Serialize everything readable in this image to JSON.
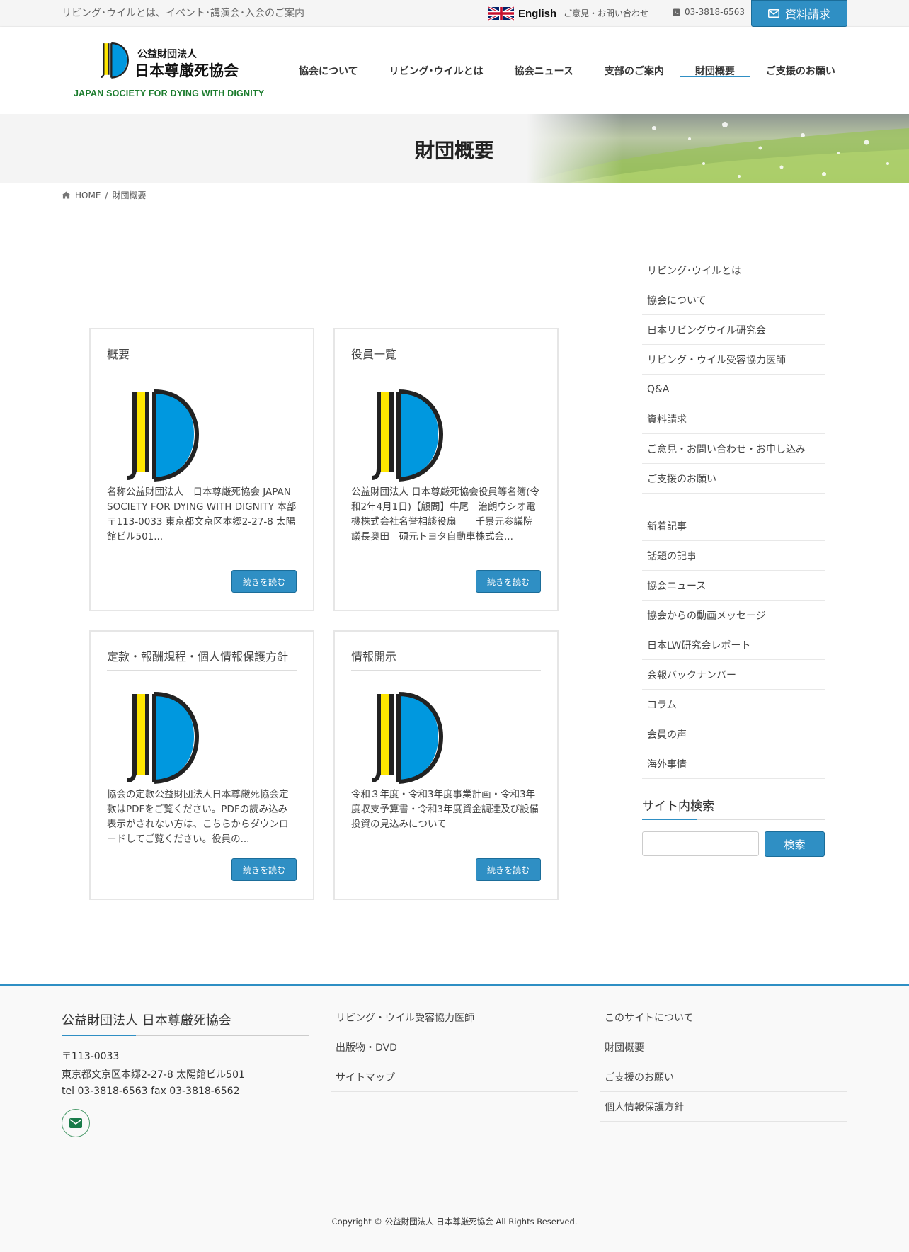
{
  "topbar": {
    "tagline": "リビング･ウイルとは、イベント･講演会･入会のご案内",
    "english_label": "English",
    "contact_label": "ご意見・お問い合わせ",
    "phone": "03-3818-6563",
    "request_button": "資料請求"
  },
  "header": {
    "logo_small": "公益財団法人",
    "logo_large": "日本尊厳死協会",
    "logo_en": "JAPAN SOCIETY FOR DYING WITH DIGNITY",
    "nav": [
      {
        "label": "協会について"
      },
      {
        "label": "リビング･ウイルとは"
      },
      {
        "label": "協会ニュース"
      },
      {
        "label": "支部のご案内"
      },
      {
        "label": "財団概要"
      },
      {
        "label": "ご支援のお願い"
      }
    ],
    "active_nav_index": 4
  },
  "hero": {
    "title": "財団概要"
  },
  "breadcrumb": {
    "home": "HOME",
    "current": "財団概要"
  },
  "cards": [
    {
      "title": "概要",
      "text": "名称公益財団法人　日本尊厳死協会 JAPAN SOCIETY FOR DYING WITH DIGNITY 本部〒113-0033 東京都文京区本郷2-27-8 太陽館ビル501...",
      "button": "続きを読む"
    },
    {
      "title": "役員一覧",
      "text": "公益財団法人 日本尊厳死協会役員等名簿(令和2年4月1日)【顧問】牛尾　治朗ウシオ電機株式会社名誉相談役扇　　千景元参議院議長奥田　碩元トヨタ自動車株式会...",
      "button": "続きを読む"
    },
    {
      "title": "定款・報酬規程・個人情報保護方針",
      "text": "協会の定款公益財団法人日本尊厳死協会定款はPDFをご覧ください。PDFの読み込み表示がされない方は、こちらからダウンロードしてご覧ください。役員の...",
      "button": "続きを読む"
    },
    {
      "title": "情報開示",
      "text": "令和３年度・令和3年度事業計画・令和3年度収支予算書・令和3年度資金調達及び設備投資の見込みについて",
      "button": "続きを読む"
    }
  ],
  "sidebar": {
    "menu1": [
      "リビング･ウイルとは",
      "協会について",
      "日本リビングウイル研究会",
      "リビング・ウイル受容協力医師",
      "Q&A",
      "資料請求",
      "ご意見・お問い合わせ・お申し込み",
      "ご支援のお願い"
    ],
    "menu2": [
      "新着記事",
      "話題の記事",
      "協会ニュース",
      "協会からの動画メッセージ",
      "日本LW研究会レポート",
      "会報バックナンバー",
      "コラム",
      "会員の声",
      "海外事情"
    ],
    "search_title": "サイト内検索",
    "search_button": "検索",
    "search_value": ""
  },
  "footer": {
    "org_name": "公益財団法人 日本尊厳死協会",
    "postal": "〒113-0033",
    "address": "東京都文京区本郷2-27-8 太陽館ビル501",
    "tel_fax": "tel 03-3818-6563 fax 03-3818-6562",
    "col2": [
      "リビング・ウイル受容協力医師",
      "出版物・DVD",
      "サイトマップ"
    ],
    "col3": [
      "このサイトについて",
      "財団概要",
      "ご支援のお願い",
      "個人情報保護方針"
    ],
    "copyright": "Copyright © 公益財団法人 日本尊厳死協会 All Rights Reserved."
  },
  "colors": {
    "accent": "#2f8fc4",
    "logo_green": "#1a7b2c",
    "logo_blue": "#0098df",
    "logo_yellow": "#ffe600"
  }
}
